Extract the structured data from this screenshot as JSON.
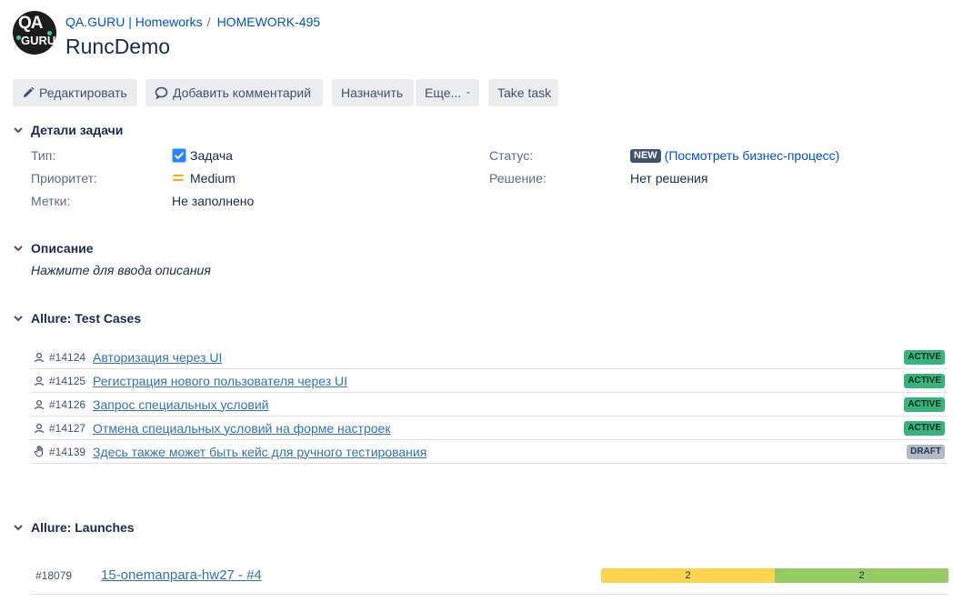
{
  "header": {
    "avatar_text_top": "QA",
    "avatar_text_bottom": "GURU",
    "breadcrumb_project": "QA.GURU | Homeworks",
    "breadcrumb_separator": "/",
    "breadcrumb_issue": "HOMEWORK-495",
    "title": "RuncDemo"
  },
  "toolbar": {
    "edit_label": "Редактировать",
    "comment_label": "Добавить комментарий",
    "assign_label": "Назначить",
    "more_label": "Еще...",
    "take_task_label": "Take task"
  },
  "details": {
    "heading": "Детали задачи",
    "type_label": "Тип:",
    "type_value": "Задача",
    "priority_label": "Приоритет:",
    "priority_value": "Medium",
    "labels_label": "Метки:",
    "labels_value": "Не заполнено",
    "status_label": "Статус:",
    "status_lozenge": "NEW",
    "status_link": "(Посмотреть бизнес-процесс)",
    "resolution_label": "Решение:",
    "resolution_value": "Нет решения"
  },
  "description": {
    "heading": "Описание",
    "placeholder": "Нажмите для ввода описания"
  },
  "test_cases": {
    "heading": "Allure: Test Cases",
    "items": [
      {
        "icon": "user-icon",
        "id": "#14124",
        "name": "Авторизация через UI",
        "status": "ACTIVE"
      },
      {
        "icon": "user-icon",
        "id": "#14125",
        "name": "Регистрация нового пользователя через UI",
        "status": "ACTIVE"
      },
      {
        "icon": "user-icon",
        "id": "#14126",
        "name": "Запрос специальных условий",
        "status": "ACTIVE"
      },
      {
        "icon": "user-icon",
        "id": "#14127",
        "name": "Отмена специальных условий на форме настроек",
        "status": "ACTIVE"
      },
      {
        "icon": "hand-icon",
        "id": "#14139",
        "name": "Здесь также может быть кейс для ручного тестирования",
        "status": "DRAFT"
      }
    ]
  },
  "launches": {
    "heading": "Allure: Launches",
    "items": [
      {
        "id": "#18079",
        "name": "15-onemanpara-hw27 - #4",
        "segments": [
          {
            "value": "2",
            "color": "#fdd44e"
          },
          {
            "value": "2",
            "color": "#97cc64"
          }
        ]
      }
    ]
  },
  "colors": {
    "link": "#0052cc",
    "active_badge": "#36b37e",
    "draft_badge": "#b3bac5",
    "checkbox_blue": "#2684ff",
    "priority_orange": "#ffab00"
  }
}
